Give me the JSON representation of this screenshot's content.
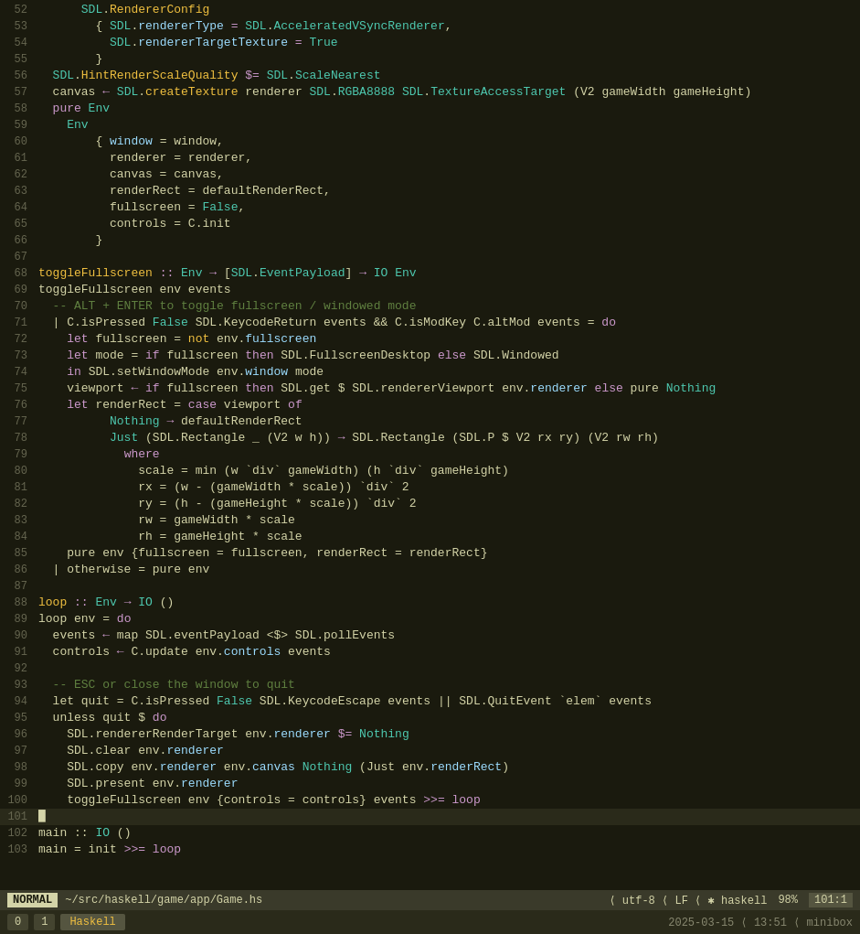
{
  "editor": {
    "lines": [
      {
        "num": "52",
        "tokens": [
          {
            "t": "      ",
            "c": "sym"
          },
          {
            "t": "SDL",
            "c": "mod"
          },
          {
            "t": ".",
            "c": "sym"
          },
          {
            "t": "RendererConfig",
            "c": "fn"
          }
        ]
      },
      {
        "num": "53",
        "tokens": [
          {
            "t": "        { ",
            "c": "sym"
          },
          {
            "t": "SDL",
            "c": "mod"
          },
          {
            "t": ".",
            "c": "sym"
          },
          {
            "t": "rendererType",
            "c": "field"
          },
          {
            "t": " = ",
            "c": "op"
          },
          {
            "t": "SDL",
            "c": "mod"
          },
          {
            "t": ".",
            "c": "sym"
          },
          {
            "t": "AcceleratedVSyncRenderer",
            "c": "ctor"
          },
          {
            "t": ",",
            "c": "sym"
          }
        ]
      },
      {
        "num": "54",
        "tokens": [
          {
            "t": "          ",
            "c": "sym"
          },
          {
            "t": "SDL",
            "c": "mod"
          },
          {
            "t": ".",
            "c": "sym"
          },
          {
            "t": "rendererTargetTexture",
            "c": "field"
          },
          {
            "t": " = ",
            "c": "op"
          },
          {
            "t": "True",
            "c": "ctor"
          }
        ]
      },
      {
        "num": "55",
        "tokens": [
          {
            "t": "        }",
            "c": "sym"
          }
        ]
      },
      {
        "num": "56",
        "tokens": [
          {
            "t": "  SDL",
            "c": "mod"
          },
          {
            "t": ".",
            "c": "sym"
          },
          {
            "t": "HintRenderScaleQuality",
            "c": "fn"
          },
          {
            "t": " $= ",
            "c": "op"
          },
          {
            "t": "SDL",
            "c": "mod"
          },
          {
            "t": ".",
            "c": "sym"
          },
          {
            "t": "ScaleNearest",
            "c": "ctor"
          }
        ]
      },
      {
        "num": "57",
        "tokens": [
          {
            "t": "  canvas ",
            "c": "sym"
          },
          {
            "t": "←",
            "c": "arrow"
          },
          {
            "t": " ",
            "c": "sym"
          },
          {
            "t": "SDL",
            "c": "mod"
          },
          {
            "t": ".",
            "c": "sym"
          },
          {
            "t": "createTexture",
            "c": "fn"
          },
          {
            "t": " renderer ",
            "c": "sym"
          },
          {
            "t": "SDL",
            "c": "mod"
          },
          {
            "t": ".",
            "c": "sym"
          },
          {
            "t": "RGBA8888",
            "c": "ctor"
          },
          {
            "t": " ",
            "c": "sym"
          },
          {
            "t": "SDL",
            "c": "mod"
          },
          {
            "t": ".",
            "c": "sym"
          },
          {
            "t": "TextureAccessTarget",
            "c": "ctor"
          },
          {
            "t": " (V2 gameWidth gameHeight)",
            "c": "sym"
          }
        ]
      },
      {
        "num": "58",
        "tokens": [
          {
            "t": "  pure",
            "c": "kw"
          },
          {
            "t": " Env",
            "c": "ty"
          }
        ]
      },
      {
        "num": "59",
        "tokens": [
          {
            "t": "    Env",
            "c": "ty"
          }
        ]
      },
      {
        "num": "60",
        "tokens": [
          {
            "t": "        { ",
            "c": "sym"
          },
          {
            "t": "window",
            "c": "field"
          },
          {
            "t": " = window,",
            "c": "sym"
          }
        ]
      },
      {
        "num": "61",
        "tokens": [
          {
            "t": "          renderer = renderer,",
            "c": "sym"
          }
        ]
      },
      {
        "num": "62",
        "tokens": [
          {
            "t": "          canvas = canvas,",
            "c": "sym"
          }
        ]
      },
      {
        "num": "63",
        "tokens": [
          {
            "t": "          renderRect = defaultRenderRect,",
            "c": "sym"
          }
        ]
      },
      {
        "num": "64",
        "tokens": [
          {
            "t": "          fullscreen = ",
            "c": "sym"
          },
          {
            "t": "False",
            "c": "ctor"
          },
          {
            "t": ",",
            "c": "sym"
          }
        ]
      },
      {
        "num": "65",
        "tokens": [
          {
            "t": "          controls = C.init",
            "c": "sym"
          }
        ]
      },
      {
        "num": "66",
        "tokens": [
          {
            "t": "        }",
            "c": "sym"
          }
        ]
      },
      {
        "num": "67",
        "tokens": []
      },
      {
        "num": "68",
        "tokens": [
          {
            "t": "toggleFullscreen",
            "c": "fn"
          },
          {
            "t": " :: ",
            "c": "op"
          },
          {
            "t": "Env",
            "c": "ty"
          },
          {
            "t": " ",
            "c": "sym"
          },
          {
            "t": "→",
            "c": "arrow"
          },
          {
            "t": " [",
            "c": "sym"
          },
          {
            "t": "SDL",
            "c": "mod"
          },
          {
            "t": ".",
            "c": "sym"
          },
          {
            "t": "EventPayload",
            "c": "ty"
          },
          {
            "t": "] ",
            "c": "sym"
          },
          {
            "t": "→",
            "c": "arrow"
          },
          {
            "t": " ",
            "c": "sym"
          },
          {
            "t": "IO",
            "c": "ty"
          },
          {
            "t": " ",
            "c": "sym"
          },
          {
            "t": "Env",
            "c": "ty"
          }
        ]
      },
      {
        "num": "69",
        "tokens": [
          {
            "t": "toggleFullscreen env events",
            "c": "sym"
          }
        ]
      },
      {
        "num": "70",
        "tokens": [
          {
            "t": "  -- ALT + ENTER to toggle fullscreen / windowed mode",
            "c": "cm"
          }
        ]
      },
      {
        "num": "71",
        "tokens": [
          {
            "t": "  | C.isPressed ",
            "c": "sym"
          },
          {
            "t": "False",
            "c": "ctor"
          },
          {
            "t": " SDL.KeycodeReturn events && C.isModKey C.altMod events = ",
            "c": "sym"
          },
          {
            "t": "do",
            "c": "kw"
          }
        ]
      },
      {
        "num": "72",
        "tokens": [
          {
            "t": "    ",
            "c": "sym"
          },
          {
            "t": "let",
            "c": "kw"
          },
          {
            "t": " fullscreen = ",
            "c": "sym"
          },
          {
            "t": "not",
            "c": "fn"
          },
          {
            "t": " env.",
            "c": "sym"
          },
          {
            "t": "fullscreen",
            "c": "field"
          }
        ]
      },
      {
        "num": "73",
        "tokens": [
          {
            "t": "    ",
            "c": "sym"
          },
          {
            "t": "let",
            "c": "kw"
          },
          {
            "t": " mode = ",
            "c": "sym"
          },
          {
            "t": "if",
            "c": "kw"
          },
          {
            "t": " fullscreen ",
            "c": "sym"
          },
          {
            "t": "then",
            "c": "kw"
          },
          {
            "t": " SDL.FullscreenDesktop ",
            "c": "sym"
          },
          {
            "t": "else",
            "c": "kw"
          },
          {
            "t": " SDL.Windowed",
            "c": "sym"
          }
        ]
      },
      {
        "num": "74",
        "tokens": [
          {
            "t": "    ",
            "c": "sym"
          },
          {
            "t": "in",
            "c": "kw"
          },
          {
            "t": " SDL.setWindowMode env.",
            "c": "sym"
          },
          {
            "t": "window",
            "c": "field"
          },
          {
            "t": " mode",
            "c": "sym"
          }
        ]
      },
      {
        "num": "75",
        "tokens": [
          {
            "t": "    viewport ",
            "c": "sym"
          },
          {
            "t": "←",
            "c": "arrow"
          },
          {
            "t": " ",
            "c": "sym"
          },
          {
            "t": "if",
            "c": "kw"
          },
          {
            "t": " fullscreen ",
            "c": "sym"
          },
          {
            "t": "then",
            "c": "kw"
          },
          {
            "t": " SDL.get $ SDL.rendererViewport env.",
            "c": "sym"
          },
          {
            "t": "renderer",
            "c": "field"
          },
          {
            "t": " ",
            "c": "sym"
          },
          {
            "t": "else",
            "c": "kw"
          },
          {
            "t": " pure ",
            "c": "sym"
          },
          {
            "t": "Nothing",
            "c": "ctor"
          }
        ]
      },
      {
        "num": "76",
        "tokens": [
          {
            "t": "    ",
            "c": "sym"
          },
          {
            "t": "let",
            "c": "kw"
          },
          {
            "t": " renderRect = ",
            "c": "sym"
          },
          {
            "t": "case",
            "c": "kw"
          },
          {
            "t": " viewport ",
            "c": "sym"
          },
          {
            "t": "of",
            "c": "kw"
          }
        ]
      },
      {
        "num": "77",
        "tokens": [
          {
            "t": "          ",
            "c": "sym"
          },
          {
            "t": "Nothing",
            "c": "ctor"
          },
          {
            "t": " ",
            "c": "sym"
          },
          {
            "t": "→",
            "c": "arrow"
          },
          {
            "t": " defaultRenderRect",
            "c": "sym"
          }
        ]
      },
      {
        "num": "78",
        "tokens": [
          {
            "t": "          ",
            "c": "sym"
          },
          {
            "t": "Just",
            "c": "ctor"
          },
          {
            "t": " (SDL.Rectangle _ (V2 w h)) ",
            "c": "sym"
          },
          {
            "t": "→",
            "c": "arrow"
          },
          {
            "t": " SDL.Rectangle (SDL.P $ V2 rx ry) (V2 rw rh)",
            "c": "sym"
          }
        ]
      },
      {
        "num": "79",
        "tokens": [
          {
            "t": "            ",
            "c": "sym"
          },
          {
            "t": "where",
            "c": "kw"
          }
        ]
      },
      {
        "num": "80",
        "tokens": [
          {
            "t": "              scale = min (w `div` gameWidth) (h `div` gameHeight)",
            "c": "sym"
          }
        ]
      },
      {
        "num": "81",
        "tokens": [
          {
            "t": "              rx = (w - (gameWidth * scale)) `div` 2",
            "c": "sym"
          }
        ]
      },
      {
        "num": "82",
        "tokens": [
          {
            "t": "              ry = (h - (gameHeight * scale)) `div` 2",
            "c": "sym"
          }
        ]
      },
      {
        "num": "83",
        "tokens": [
          {
            "t": "              rw = gameWidth * scale",
            "c": "sym"
          }
        ]
      },
      {
        "num": "84",
        "tokens": [
          {
            "t": "              rh = gameHeight * scale",
            "c": "sym"
          }
        ]
      },
      {
        "num": "85",
        "tokens": [
          {
            "t": "    pure env {fullscreen = fullscreen, renderRect = renderRect}",
            "c": "sym"
          }
        ]
      },
      {
        "num": "86",
        "tokens": [
          {
            "t": "  | otherwise = pure env",
            "c": "sym"
          }
        ]
      },
      {
        "num": "87",
        "tokens": []
      },
      {
        "num": "88",
        "tokens": [
          {
            "t": "loop",
            "c": "fn"
          },
          {
            "t": " :: ",
            "c": "op"
          },
          {
            "t": "Env",
            "c": "ty"
          },
          {
            "t": " ",
            "c": "sym"
          },
          {
            "t": "→",
            "c": "arrow"
          },
          {
            "t": " ",
            "c": "sym"
          },
          {
            "t": "IO",
            "c": "ty"
          },
          {
            "t": " ()",
            "c": "sym"
          }
        ]
      },
      {
        "num": "89",
        "tokens": [
          {
            "t": "loop env = ",
            "c": "sym"
          },
          {
            "t": "do",
            "c": "kw"
          }
        ]
      },
      {
        "num": "90",
        "tokens": [
          {
            "t": "  events ",
            "c": "sym"
          },
          {
            "t": "←",
            "c": "arrow"
          },
          {
            "t": " map SDL.eventPayload <$> SDL.pollEvents",
            "c": "sym"
          }
        ]
      },
      {
        "num": "91",
        "tokens": [
          {
            "t": "  controls ",
            "c": "sym"
          },
          {
            "t": "←",
            "c": "arrow"
          },
          {
            "t": " C.update env.",
            "c": "sym"
          },
          {
            "t": "controls",
            "c": "field"
          },
          {
            "t": " events",
            "c": "sym"
          }
        ]
      },
      {
        "num": "92",
        "tokens": []
      },
      {
        "num": "93",
        "tokens": [
          {
            "t": "  -- ESC or close the window to quit",
            "c": "cm"
          }
        ]
      },
      {
        "num": "94",
        "tokens": [
          {
            "t": "  let quit = C.isPressed ",
            "c": "sym"
          },
          {
            "t": "False",
            "c": "ctor"
          },
          {
            "t": " SDL.KeycodeEscape events || SDL.QuitEvent `elem` events",
            "c": "sym"
          }
        ]
      },
      {
        "num": "95",
        "tokens": [
          {
            "t": "  unless quit $ ",
            "c": "sym"
          },
          {
            "t": "do",
            "c": "kw"
          }
        ]
      },
      {
        "num": "96",
        "tokens": [
          {
            "t": "    SDL.rendererRenderTarget env.",
            "c": "sym"
          },
          {
            "t": "renderer",
            "c": "field"
          },
          {
            "t": " $= ",
            "c": "op"
          },
          {
            "t": "Nothing",
            "c": "ctor"
          }
        ]
      },
      {
        "num": "97",
        "tokens": [
          {
            "t": "    SDL.clear env.",
            "c": "sym"
          },
          {
            "t": "renderer",
            "c": "field"
          }
        ]
      },
      {
        "num": "98",
        "tokens": [
          {
            "t": "    SDL.copy env.",
            "c": "sym"
          },
          {
            "t": "renderer",
            "c": "field"
          },
          {
            "t": " env.",
            "c": "sym"
          },
          {
            "t": "canvas",
            "c": "field"
          },
          {
            "t": " ",
            "c": "sym"
          },
          {
            "t": "Nothing",
            "c": "ctor"
          },
          {
            "t": " (Just env.",
            "c": "sym"
          },
          {
            "t": "renderRect",
            "c": "field"
          },
          {
            "t": ")",
            "c": "sym"
          }
        ]
      },
      {
        "num": "99",
        "tokens": [
          {
            "t": "    SDL.present env.",
            "c": "sym"
          },
          {
            "t": "renderer",
            "c": "field"
          }
        ]
      },
      {
        "num": "100",
        "tokens": [
          {
            "t": "    toggleFullscreen env {controls = controls} events ",
            "c": "sym"
          },
          {
            "t": ">>= loop",
            "c": "op"
          }
        ]
      },
      {
        "num": "101",
        "tokens": [
          {
            "t": "█",
            "c": "sym"
          }
        ]
      },
      {
        "num": "102",
        "tokens": [
          {
            "t": "main :: ",
            "c": "sym"
          },
          {
            "t": "IO",
            "c": "ty"
          },
          {
            "t": " ()",
            "c": "sym"
          }
        ]
      },
      {
        "num": "103",
        "tokens": [
          {
            "t": "main = init ",
            "c": "sym"
          },
          {
            "t": ">>= loop",
            "c": "op"
          }
        ]
      }
    ],
    "cursor_line": 101
  },
  "statusbar": {
    "mode": "NORMAL",
    "file": "~/src/haskell/game/app/Game.hs",
    "encoding": "utf-8",
    "line_ending": "LF",
    "filetype": "haskell",
    "filetype_icon": "ℏ",
    "percent": "98%",
    "position": "101:1"
  },
  "bottombar": {
    "tab1_num": "0",
    "tab2_num": "1",
    "lang_label": "Haskell",
    "datetime": "2025-03-15",
    "time": "13:51",
    "app": "minibox"
  }
}
